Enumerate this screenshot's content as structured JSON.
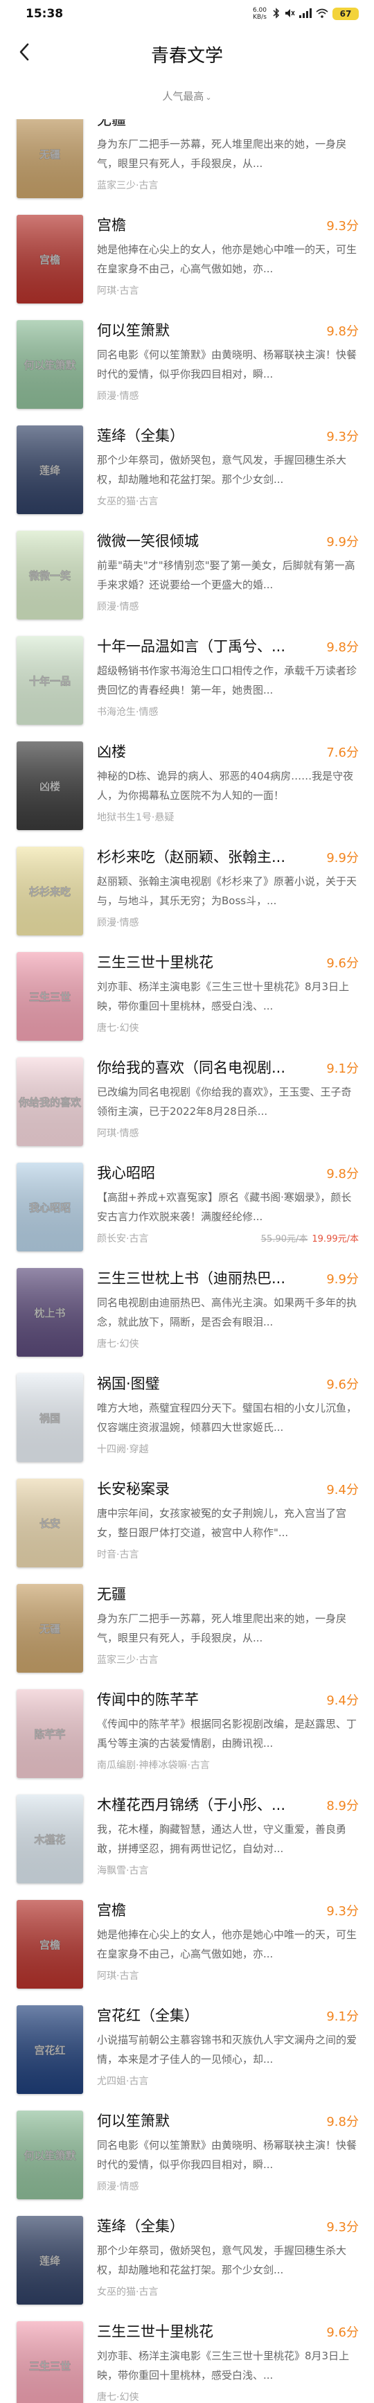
{
  "status": {
    "time": "15:38",
    "network": "6.00 KB/s",
    "battery": "67"
  },
  "header": {
    "title": "青春文学",
    "sort_label": "人气最高"
  },
  "books": [
    {
      "title": "无疆",
      "score": "",
      "desc": "身为东厂二把手一苏幕，死人堆里爬出来的她，一身戾气，眼里只有死人，手段狠戾，从...",
      "meta": "蓝家三少·古言",
      "cover_color": "#c9a36a",
      "cover_text": "无疆"
    },
    {
      "title": "宫檐",
      "score": "9.3分",
      "desc": "她是他捧在心尖上的女人，他亦是她心中唯一的天，可生在皇家身不由己，心高气傲如她，亦...",
      "meta": "阿琪·古言",
      "cover_color": "#b5322b",
      "cover_text": "宫檐"
    },
    {
      "title": "何以笙箫默",
      "score": "9.8分",
      "desc": "同名电影《何以笙箫默》由黄晓明、杨幂联袂主演！快餐时代的爱情，似乎你我四目相对，瞬...",
      "meta": "顾漫·情感",
      "cover_color": "#8fbf9a",
      "cover_text": "何以笙箫默"
    },
    {
      "title": "莲绛（全集）",
      "score": "9.3分",
      "desc": "那个少年祭司，傲娇哭包，意气风发，手握回穗生杀大权，却劫雕地和花盆打架。那个少女剑...",
      "meta": "女巫的猫·古言",
      "cover_color": "#2f3f63",
      "cover_text": "莲绛"
    },
    {
      "title": "微微一笑很倾城",
      "score": "9.9分",
      "desc": "前辈\"萌夫\"才\"移情别恋\"娶了第一美女，后脚就有第一高手来求婚？还说要给一个更盛大的婚...",
      "meta": "顾漫·情感",
      "cover_color": "#d6e9c6",
      "cover_text": "微微一笑"
    },
    {
      "title": "十年一品温如言（丁禹兮、...",
      "score": "9.8分",
      "desc": "超级畅销书作家书海沧生口口相传之作，承载千万读者珍贵回忆的青春经典！第一年，她贵图...",
      "meta": "书海沧生·情感",
      "cover_color": "#d9ecd4",
      "cover_text": "十年一品"
    },
    {
      "title": "凶楼",
      "score": "7.6分",
      "desc": "神秘的D栋、诡异的病人、邪恶的404病房……我是守夜人，为你揭幕私立医院不为人知的一面！",
      "meta": "地狱书生1号·悬疑",
      "cover_color": "#3a3a3a",
      "cover_text": "凶楼"
    },
    {
      "title": "杉杉来吃（赵丽颖、张翰主...",
      "score": "9.9分",
      "desc": "赵丽颖、张翰主演电视剧《杉杉来了》原著小说，关于天与，与地斗，其乐无穷；为Boss斗，...",
      "meta": "顾漫·情感",
      "cover_color": "#f2e6a8",
      "cover_text": "杉杉来吃"
    },
    {
      "title": "三生三世十里桃花",
      "score": "9.6分",
      "desc": "刘亦菲、杨洋主演电影《三生三世十里桃花》8月3日上映，带你重回十里桃林，感受白浅、...",
      "meta": "唐七·幻侠",
      "cover_color": "#f4a3b4",
      "cover_text": "三生三世"
    },
    {
      "title": "你给我的喜欢（同名电视剧...",
      "score": "9.1分",
      "desc": "已改编为同名电视剧《你给我的喜欢》，王玉雯、王子奇领衔主演，已于2022年8月28日杀...",
      "meta": "阿琪·情感",
      "cover_color": "#f7d9de",
      "cover_text": "你给我的喜欢"
    },
    {
      "title": "我心昭昭",
      "score": "9.8分",
      "desc": "【高甜+养成+欢喜冤家】原名《藏书阁·寒姻录》，颜长安古言力作欢脱来袭！满腹经纶修...",
      "meta": "颜长安·古言",
      "price_old": "55.90元/本",
      "price_new": "19.99元/本",
      "cover_color": "#b8d3e8",
      "cover_text": "我心昭昭"
    },
    {
      "title": "三生三世枕上书（迪丽热巴...",
      "score": "9.9分",
      "desc": "同名电视剧由迪丽热巴、高伟光主演。如果两千多年的执念，就此放下，隔断，是否会有眼泪...",
      "meta": "唐七·幻侠",
      "cover_color": "#5b4a7a",
      "cover_text": "枕上书"
    },
    {
      "title": "祸国·图璧",
      "score": "9.6分",
      "desc": "唯方大地，燕璧宜程四分天下。璧国右相的小女儿沉鱼，仅容端庄资淑温婉，倾慕四大世家姬氏...",
      "meta": "十四阙·穿越",
      "cover_color": "#e8eef4",
      "cover_text": "祸国"
    },
    {
      "title": "长安秘案录",
      "score": "9.4分",
      "desc": "唐中宗年间，女孩家被冤的女子荆婉儿，充入宫当了宫女，整日跟尸体打交道，被宫中人称作\"...",
      "meta": "时音·古言",
      "cover_color": "#ecd9b0",
      "cover_text": "长安"
    },
    {
      "title": "无疆",
      "score": "",
      "desc": "身为东厂二把手一苏幕，死人堆里爬出来的她，一身戾气，眼里只有死人，手段狠戾，从...",
      "meta": "蓝家三少·古言",
      "cover_color": "#c9a36a",
      "cover_text": "无疆"
    },
    {
      "title": "传闻中的陈芊芊",
      "score": "9.4分",
      "desc": "《传闻中的陈芊芊》根据同名影视剧改编，是赵露思、丁禹兮等主演的古装爱情剧，由腾讯视...",
      "meta": "南瓜编剧·神棒冰袋嘛·古言",
      "cover_color": "#f0c9cf",
      "cover_text": "陈芊芊"
    },
    {
      "title": "木槿花西月锦绣（于小彤、...",
      "score": "8.9分",
      "desc": "我，花木槿，胸藏智慧，通达人世，守义重爱，善良勇敢，拼搏坚忍，拥有两世记忆，自幼对...",
      "meta": "海飘雪·古言",
      "cover_color": "#dbe6ee",
      "cover_text": "木槿花"
    },
    {
      "title": "宫檐",
      "score": "9.3分",
      "desc": "她是他捧在心尖上的女人，他亦是她心中唯一的天，可生在皇家身不由己，心高气傲如她，亦...",
      "meta": "阿琪·古言",
      "cover_color": "#b5322b",
      "cover_text": "宫檐"
    },
    {
      "title": "宫花红（全集）",
      "score": "9.1分",
      "desc": "小说描写前朝公主慕容锦书和灭族仇人宇文澜舟之间的爱情，本来是才子佳人的一见倾心，却...",
      "meta": "尤四姐·古言",
      "cover_color": "#1f3f7a",
      "cover_text": "宫花红"
    },
    {
      "title": "何以笙箫默",
      "score": "9.8分",
      "desc": "同名电影《何以笙箫默》由黄晓明、杨幂联袂主演！快餐时代的爱情，似乎你我四目相对，瞬...",
      "meta": "顾漫·情感",
      "cover_color": "#8fbf9a",
      "cover_text": "何以笙箫默"
    },
    {
      "title": "莲绛（全集）",
      "score": "9.3分",
      "desc": "那个少年祭司，傲娇哭包，意气风发，手握回穗生杀大权，却劫雕地和花盆打架。那个少女剑...",
      "meta": "女巫的猫·古言",
      "cover_color": "#2f3f63",
      "cover_text": "莲绛"
    },
    {
      "title": "三生三世十里桃花",
      "score": "9.6分",
      "desc": "刘亦菲、杨洋主演电影《三生三世十里桃花》8月3日上映，带你重回十里桃林，感受白浅、...",
      "meta": "唐七·幻侠",
      "cover_color": "#f4a3b4",
      "cover_text": "三生三世"
    }
  ]
}
